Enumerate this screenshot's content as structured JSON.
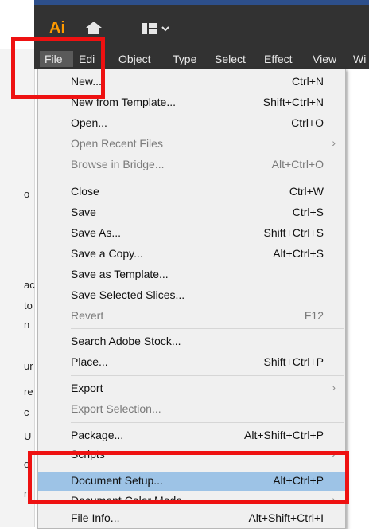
{
  "app": {
    "logo_text": "Ai",
    "icons": {
      "home": "home-icon",
      "workspace": "workspace-switcher-icon"
    }
  },
  "menubar": {
    "items": [
      {
        "label": "File",
        "active": true
      },
      {
        "label": "Edi"
      },
      {
        "label": "Object"
      },
      {
        "label": "Type"
      },
      {
        "label": "Select"
      },
      {
        "label": "Effect"
      },
      {
        "label": "View"
      },
      {
        "label": "Wi"
      }
    ]
  },
  "left_fragments": [
    "o",
    "ac",
    "to",
    "n",
    "ur",
    "re",
    "c",
    "U",
    "o",
    "ri"
  ],
  "file_menu": {
    "items": [
      {
        "label": "New...",
        "shortcut": "Ctrl+N"
      },
      {
        "label": "New from Template...",
        "shortcut": "Shift+Ctrl+N"
      },
      {
        "label": "Open...",
        "shortcut": "Ctrl+O"
      },
      {
        "label": "Open Recent Files",
        "shortcut": "",
        "disabled": true,
        "submenu": true
      },
      {
        "label": "Browse in Bridge...",
        "shortcut": "Alt+Ctrl+O",
        "disabled": true
      },
      {
        "label": "Close",
        "shortcut": "Ctrl+W"
      },
      {
        "label": "Save",
        "shortcut": "Ctrl+S"
      },
      {
        "label": "Save As...",
        "shortcut": "Shift+Ctrl+S"
      },
      {
        "label": "Save a Copy...",
        "shortcut": "Alt+Ctrl+S"
      },
      {
        "label": "Save as Template...",
        "shortcut": ""
      },
      {
        "label": "Save Selected Slices...",
        "shortcut": ""
      },
      {
        "label": "Revert",
        "shortcut": "F12",
        "disabled": true
      },
      {
        "label": "Search Adobe Stock...",
        "shortcut": ""
      },
      {
        "label": "Place...",
        "shortcut": "Shift+Ctrl+P"
      },
      {
        "label": "Export",
        "shortcut": "",
        "submenu": true
      },
      {
        "label": "Export Selection...",
        "shortcut": "",
        "disabled": true
      },
      {
        "label": "Package...",
        "shortcut": "Alt+Shift+Ctrl+P"
      },
      {
        "label": "Scripts",
        "shortcut": "",
        "submenu": true
      },
      {
        "label": "Document Setup...",
        "shortcut": "Alt+Ctrl+P",
        "highlighted": true
      },
      {
        "label": "Document Color Mode",
        "shortcut": "",
        "submenu": true
      },
      {
        "label": "File Info...",
        "shortcut": "Alt+Shift+Ctrl+I"
      }
    ]
  },
  "annotations": {
    "color": "#ee1111"
  }
}
